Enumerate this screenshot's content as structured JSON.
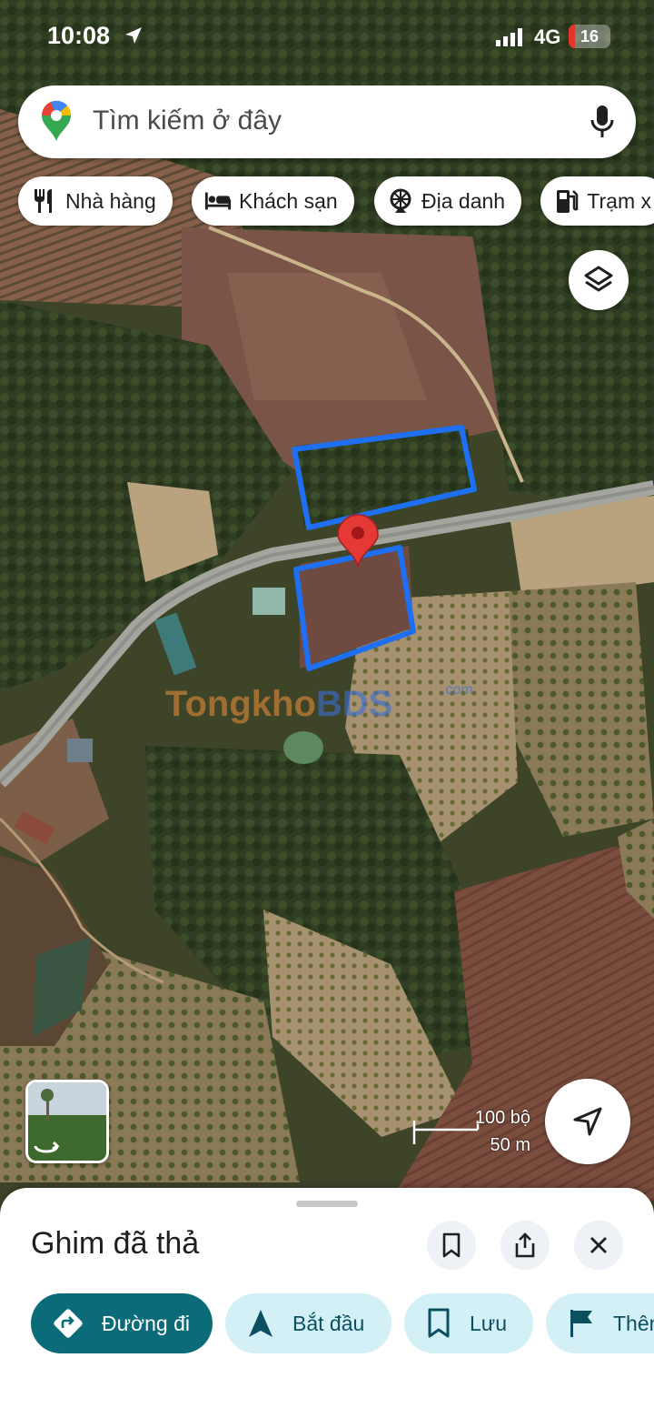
{
  "status_bar": {
    "time": "10:08",
    "network": "4G",
    "battery": "16",
    "battery_level": 0.16
  },
  "search": {
    "placeholder": "Tìm kiếm ở đây"
  },
  "chips": [
    {
      "label": "Nhà hàng",
      "icon": "restaurant-icon"
    },
    {
      "label": "Khách sạn",
      "icon": "hotel-icon"
    },
    {
      "label": "Địa danh",
      "icon": "landmark-icon"
    },
    {
      "label": "Trạm x",
      "icon": "gas-station-icon"
    }
  ],
  "map": {
    "watermark_a": "Tongkho",
    "watermark_b": "BDS",
    "watermark_suffix": ".com",
    "scale_imperial": "100 bộ",
    "scale_metric": "50 m",
    "pin_color": "#e53935",
    "outline_color": "#1e6ff2"
  },
  "sheet": {
    "title": "Ghim đã thả",
    "actions": [
      {
        "label": "Đường đi",
        "icon": "directions-icon"
      },
      {
        "label": "Bắt đầu",
        "icon": "navigation-icon"
      },
      {
        "label": "Lưu",
        "icon": "bookmark-icon"
      },
      {
        "label": "Thên",
        "icon": "flag-icon"
      }
    ]
  },
  "colors": {
    "primary_action": "#0b6b78",
    "secondary_action": "#d4f0f7"
  }
}
